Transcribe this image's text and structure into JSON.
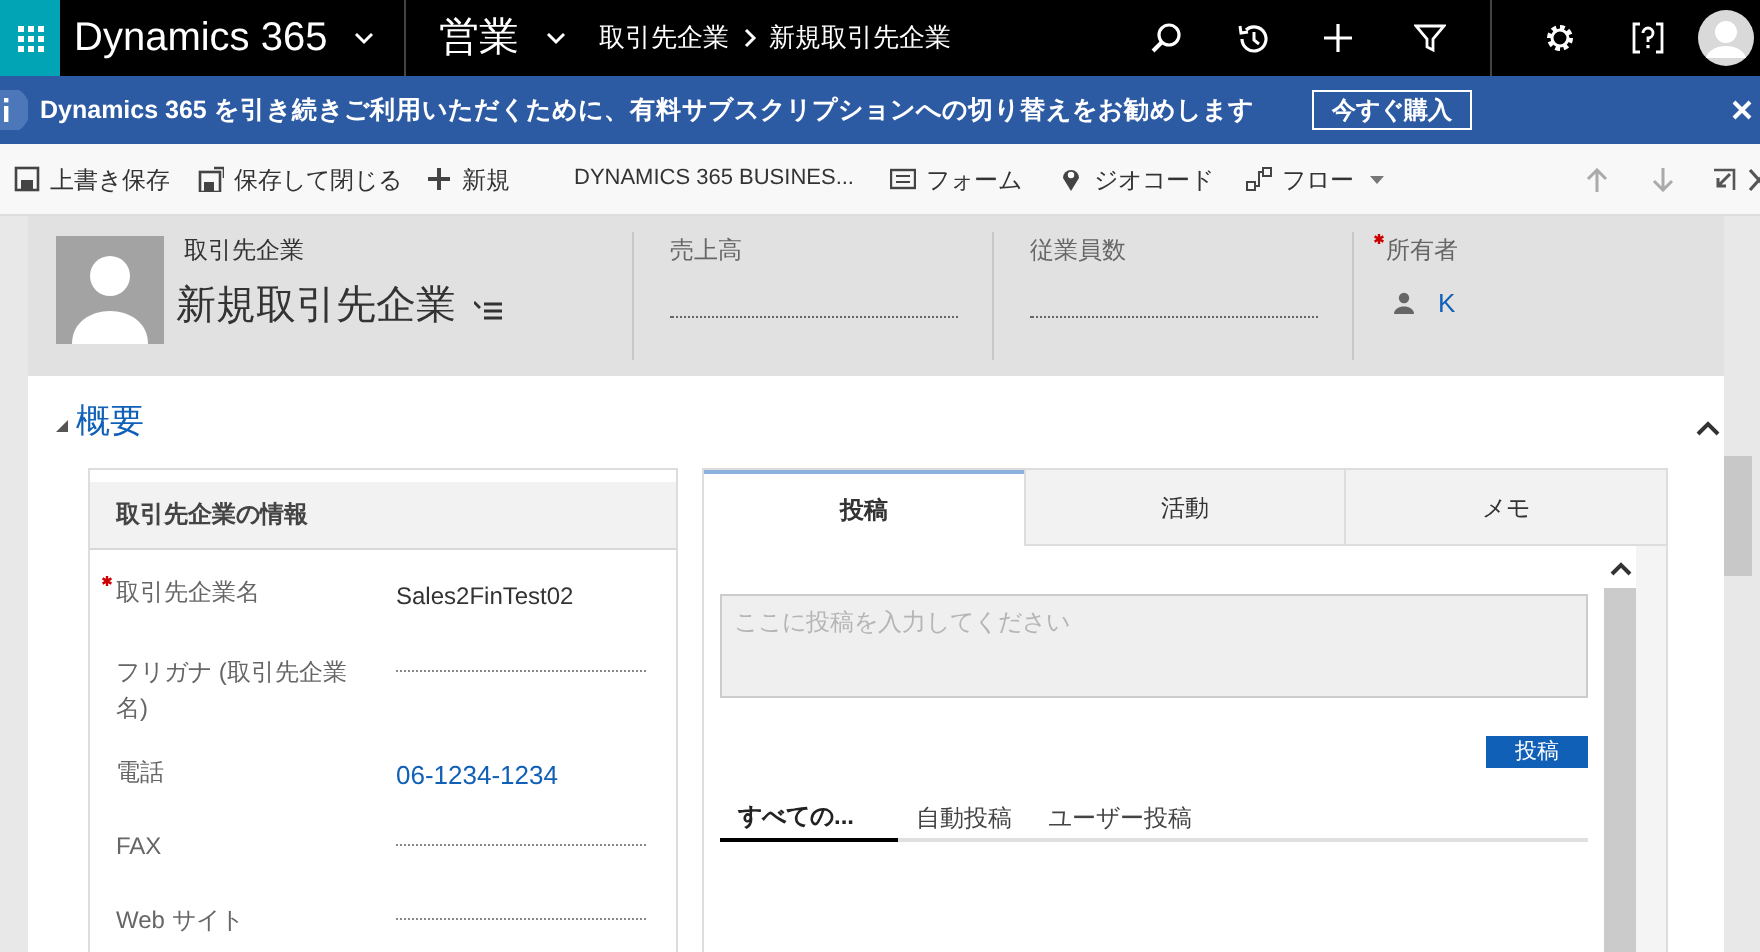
{
  "nav": {
    "app": "Dynamics 365",
    "area": "営業",
    "breadcrumb": [
      {
        "label": "取引先企業"
      },
      {
        "label": "新規取引先企業"
      }
    ]
  },
  "banner": {
    "message": "Dynamics 365 を引き続きご利用いただくために、有料サブスクリプションへの切り替えをお勧めします",
    "button": "今すぐ購入"
  },
  "toolbar": [
    {
      "kind": "save",
      "label": "上書き保存"
    },
    {
      "kind": "saveclose",
      "label": "保存して閉じる"
    },
    {
      "kind": "new",
      "label": "新規"
    },
    {
      "kind": "text",
      "label": "DYNAMICS 365 BUSINES..."
    },
    {
      "kind": "form",
      "label": "フォーム"
    },
    {
      "kind": "geo",
      "label": "ジオコード"
    },
    {
      "kind": "flow",
      "label": "フロー"
    }
  ],
  "header": {
    "entity": "取引先企業",
    "title": "新規取引先企業",
    "fields": [
      {
        "label": "売上高",
        "required": false
      },
      {
        "label": "従業員数",
        "required": false
      },
      {
        "label": "所有者",
        "required": true,
        "value": "K"
      }
    ]
  },
  "section": {
    "title": "概要",
    "expanded": true
  },
  "info_card": {
    "title": "取引先企業の情報",
    "rows": [
      {
        "label": "取引先企業名",
        "required": true,
        "value": "Sales2FinTest02"
      },
      {
        "label": "フリガナ (取引先企業名)",
        "required": false
      },
      {
        "label": "電話",
        "required": false,
        "value": "06-1234-1234",
        "link": true
      },
      {
        "label": "FAX",
        "required": false
      },
      {
        "label": "Web サイト",
        "required": false
      }
    ]
  },
  "social": {
    "tabs": [
      {
        "label": "投稿",
        "selected": true
      },
      {
        "label": "活動",
        "selected": false
      },
      {
        "label": "メモ",
        "selected": false
      }
    ],
    "post_placeholder": "ここに投稿を入力してください",
    "post_button": "投稿",
    "filters": [
      {
        "label": "すべての...",
        "selected": true
      },
      {
        "label": "自動投稿",
        "selected": false
      },
      {
        "label": "ユーザー投稿",
        "selected": false
      }
    ]
  }
}
